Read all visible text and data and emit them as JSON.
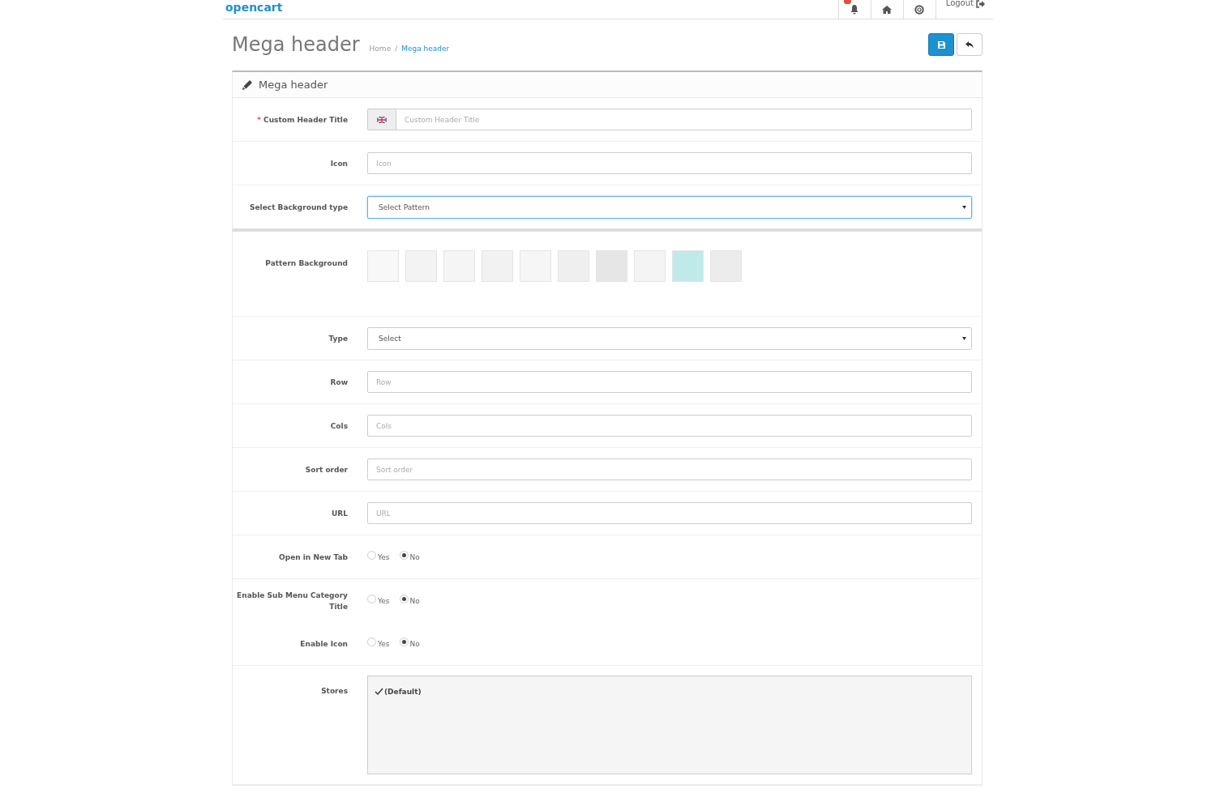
{
  "header": {
    "logo": "opencart",
    "nav": [
      {
        "kind": "bell",
        "badge": true
      },
      {
        "kind": "home"
      },
      {
        "kind": "help"
      },
      {
        "kind": "logout",
        "label": "Logout"
      }
    ]
  },
  "page": {
    "title": "Mega header",
    "breadcrumb": [
      {
        "label": "Home",
        "current": false
      },
      {
        "label": "Mega header",
        "current": true
      }
    ],
    "breadcrumb_separator": "/"
  },
  "panel": {
    "title": "Mega header",
    "rows": [
      {
        "kind": "lang-input",
        "label": "Custom Header Title",
        "required_mark": "*",
        "placeholder": "Custom Header Title"
      },
      {
        "kind": "input",
        "label": "Icon",
        "placeholder": "Icon"
      },
      {
        "kind": "select",
        "label": "Select Background type",
        "value": "Select Pattern",
        "focused": true,
        "thick_divider": true
      },
      {
        "kind": "patterns",
        "label": "Pattern Background",
        "swatches": [
          {
            "color": "#f8f8f8"
          },
          {
            "color": "#f3f3f3"
          },
          {
            "color": "#f5f5f5"
          },
          {
            "color": "#f2f2f2"
          },
          {
            "color": "#f6f6f6"
          },
          {
            "color": "#efefef"
          },
          {
            "color": "#e6e6e6"
          },
          {
            "color": "#f4f4f4"
          },
          {
            "color": "#c0e9ea"
          },
          {
            "color": "#ececec"
          }
        ]
      },
      {
        "kind": "select",
        "label": "Type",
        "value": "Select",
        "focused": false
      },
      {
        "kind": "input",
        "label": "Row",
        "placeholder": "Row"
      },
      {
        "kind": "input",
        "label": "Cols",
        "placeholder": "Cols"
      },
      {
        "kind": "input",
        "label": "Sort order",
        "placeholder": "Sort order"
      },
      {
        "kind": "input",
        "label": "URL",
        "placeholder": "URL"
      },
      {
        "kind": "radio",
        "label": "Open in New Tab",
        "options": [
          {
            "label": "Yes",
            "selected": false
          },
          {
            "label": "No",
            "selected": true
          }
        ]
      },
      {
        "kind": "radio",
        "label": "Enable Sub Menu Category Title",
        "no_divider": true,
        "options": [
          {
            "label": "Yes",
            "selected": false
          },
          {
            "label": "No",
            "selected": true
          }
        ]
      },
      {
        "kind": "radio",
        "label": "Enable Icon",
        "options": [
          {
            "label": "Yes",
            "selected": false
          },
          {
            "label": "No",
            "selected": true
          }
        ]
      },
      {
        "kind": "stores",
        "label": "Stores",
        "stores": [
          {
            "label": "(Default)",
            "checked": true
          }
        ]
      }
    ]
  }
}
